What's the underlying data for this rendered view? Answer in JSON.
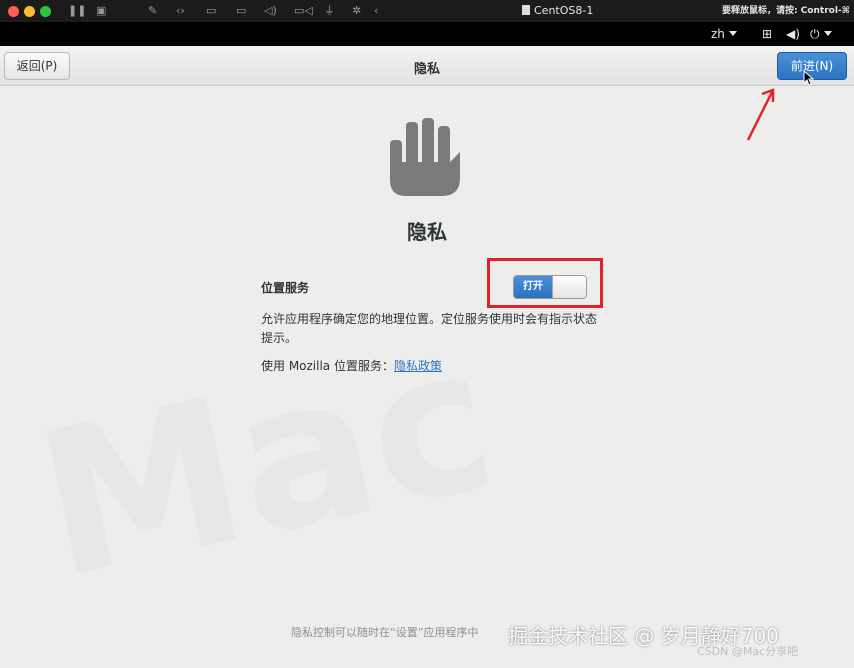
{
  "vm_window": {
    "title": "CentOS8-1",
    "release_hint": "要释放鼠标，请按: Control-⌘",
    "toolbar_icons": [
      "pause-icon",
      "snapshot-icon",
      "wrench-icon",
      "code-icon",
      "disk-icon",
      "audio-icon",
      "camera-icon",
      "usb-icon",
      "share-icon",
      "back-icon"
    ]
  },
  "gnome_bar": {
    "language": "zh",
    "icons": [
      "network-icon",
      "volume-icon",
      "power-icon"
    ]
  },
  "header": {
    "back_label": "返回(P)",
    "title": "隐私",
    "next_label": "前进(N)"
  },
  "page": {
    "icon": "hand-icon",
    "title": "隐私",
    "location_label": "位置服务",
    "toggle_state_label": "打开",
    "toggle_on": true,
    "description": "允许应用程序确定您的地理位置。定位服务使用时会有指示状态提示。",
    "mozilla_prefix": "使用 Mozilla 位置服务：",
    "policy_link": "隐私政策",
    "footer_note": "隐私控制可以随时在“设置”应用程序中"
  },
  "watermark": {
    "main": "掘金技术社区 @ 岁月静好700",
    "small": "CSDN @Mac分享吧"
  },
  "colors": {
    "accent": "#2c72c2",
    "annotation_red": "#e0232a"
  }
}
